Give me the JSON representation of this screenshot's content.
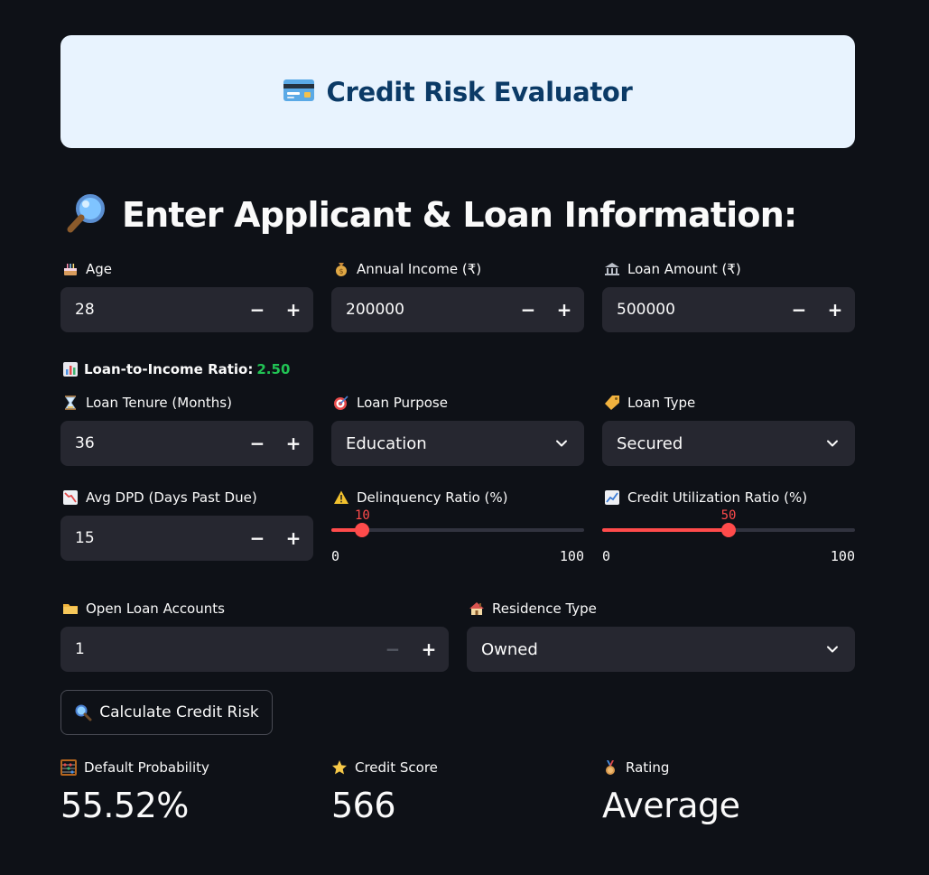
{
  "banner": {
    "title": "Credit Risk Evaluator",
    "icon": "credit-card-icon"
  },
  "section": {
    "title": "Enter Applicant & Loan Information:",
    "icon": "magnifier-icon"
  },
  "fields": {
    "age": {
      "label": "Age",
      "value": "28",
      "icon": "cake-icon"
    },
    "income": {
      "label": "Annual Income (₹)",
      "value": "200000",
      "icon": "money-bag-icon"
    },
    "loan_amount": {
      "label": "Loan Amount (₹)",
      "value": "500000",
      "icon": "bank-icon"
    },
    "tenure": {
      "label": "Loan Tenure (Months)",
      "value": "36",
      "icon": "hourglass-icon"
    },
    "purpose": {
      "label": "Loan Purpose",
      "value": "Education",
      "icon": "target-icon"
    },
    "loan_type": {
      "label": "Loan Type",
      "value": "Secured",
      "icon": "tag-icon"
    },
    "dpd": {
      "label": "Avg DPD (Days Past Due)",
      "value": "15",
      "icon": "chart-down-icon"
    },
    "delinquency": {
      "label": "Delinquency Ratio (%)",
      "value": "10",
      "min": "0",
      "max": "100",
      "fraction": 0.1,
      "icon": "warning-icon"
    },
    "utilization": {
      "label": "Credit Utilization Ratio (%)",
      "value": "50",
      "min": "0",
      "max": "100",
      "fraction": 0.5,
      "icon": "chart-up-icon"
    },
    "open_accounts": {
      "label": "Open Loan Accounts",
      "value": "1",
      "icon": "folder-icon"
    },
    "residence": {
      "label": "Residence Type",
      "value": "Owned",
      "icon": "house-icon"
    }
  },
  "ratio": {
    "label": "Loan-to-Income Ratio:",
    "value": "2.50",
    "icon": "bar-chart-icon"
  },
  "button": {
    "label": "Calculate Credit Risk",
    "icon": "search-icon"
  },
  "metrics": {
    "default_probability": {
      "label": "Default Probability",
      "value": "55.52%",
      "icon": "abacus-icon"
    },
    "credit_score": {
      "label": "Credit Score",
      "value": "566",
      "icon": "star-icon"
    },
    "rating": {
      "label": "Rating",
      "value": "Average",
      "icon": "medal-icon"
    }
  },
  "colors": {
    "accent": "#ff4b4b",
    "ratio_value": "#21c354",
    "banner_bg": "#e8f3fe",
    "banner_text": "#0b3a66",
    "background": "#0e1117",
    "input_bg": "#262730"
  }
}
